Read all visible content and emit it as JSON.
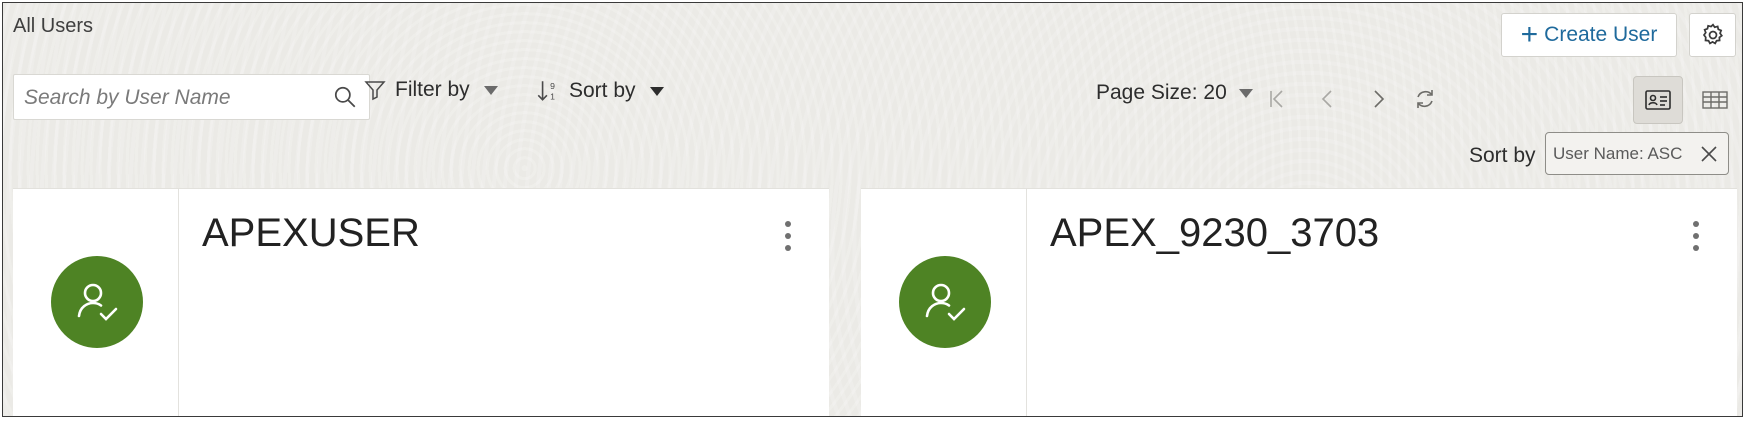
{
  "page": {
    "title": "All Users"
  },
  "header": {
    "create_user_label": "Create User",
    "create_user_icon": "plus-icon",
    "settings_icon": "gear-icon"
  },
  "toolbar": {
    "search_placeholder": "Search by User Name",
    "search_value": "",
    "filter_label": "Filter by",
    "sort_label": "Sort by",
    "page_size_label": "Page Size: 20"
  },
  "pager": {
    "icons": [
      "first-page-icon",
      "previous-page-icon",
      "next-page-icon",
      "refresh-icon"
    ]
  },
  "view_modes": {
    "active": "card-view",
    "options": [
      "card-view",
      "table-view"
    ]
  },
  "sort_summary": {
    "label": "Sort by",
    "chip_text": "User Name: ASC"
  },
  "cards": [
    {
      "username": "APEXUSER",
      "avatar_icon": "user-check-icon"
    },
    {
      "username": "APEX_9230_3703",
      "avatar_icon": "user-check-icon"
    }
  ],
  "colors": {
    "accent_link": "#1f6a9c",
    "avatar_green": "#4e8324",
    "background": "#ebeae6"
  }
}
